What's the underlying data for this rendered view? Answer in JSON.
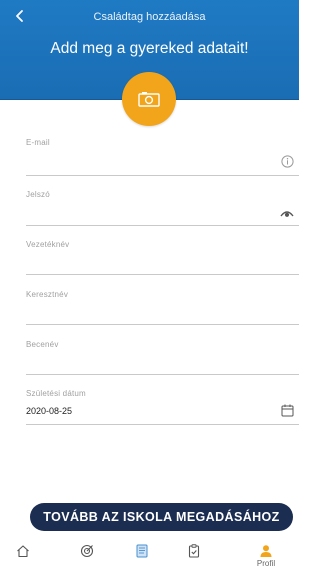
{
  "header": {
    "title": "Családtag hozzáadása",
    "subtitle": "Add meg a gyereked adatait!",
    "back_icon": "chevron-left-icon",
    "photo_icon": "camera-icon",
    "accent": "#f2a51a",
    "background": "#1f7ac4"
  },
  "form": {
    "email": {
      "label": "E-mail",
      "value": "",
      "icon": "info-icon"
    },
    "password": {
      "label": "Jelszó",
      "value": "",
      "icon": "eye-icon"
    },
    "last_name": {
      "label": "Vezetéknév",
      "value": ""
    },
    "first_name": {
      "label": "Keresztnév",
      "value": ""
    },
    "nickname": {
      "label": "Becenév",
      "value": ""
    },
    "birth_date": {
      "label": "Születési dátum",
      "value": "2020-08-25",
      "icon": "calendar-icon"
    }
  },
  "cta": {
    "label": "TOVÁBB AZ ISKOLA MEGADÁSÁHOZ",
    "color": "#1c2d52"
  },
  "tabbar": {
    "items": [
      {
        "icon": "home-icon",
        "label": ""
      },
      {
        "icon": "target-icon",
        "label": ""
      },
      {
        "icon": "book-icon",
        "label": ""
      },
      {
        "icon": "clipboard-check-icon",
        "label": ""
      },
      {
        "icon": "profile-icon",
        "label": "Profil",
        "active": true
      }
    ],
    "active_color": "#f2a51a"
  }
}
